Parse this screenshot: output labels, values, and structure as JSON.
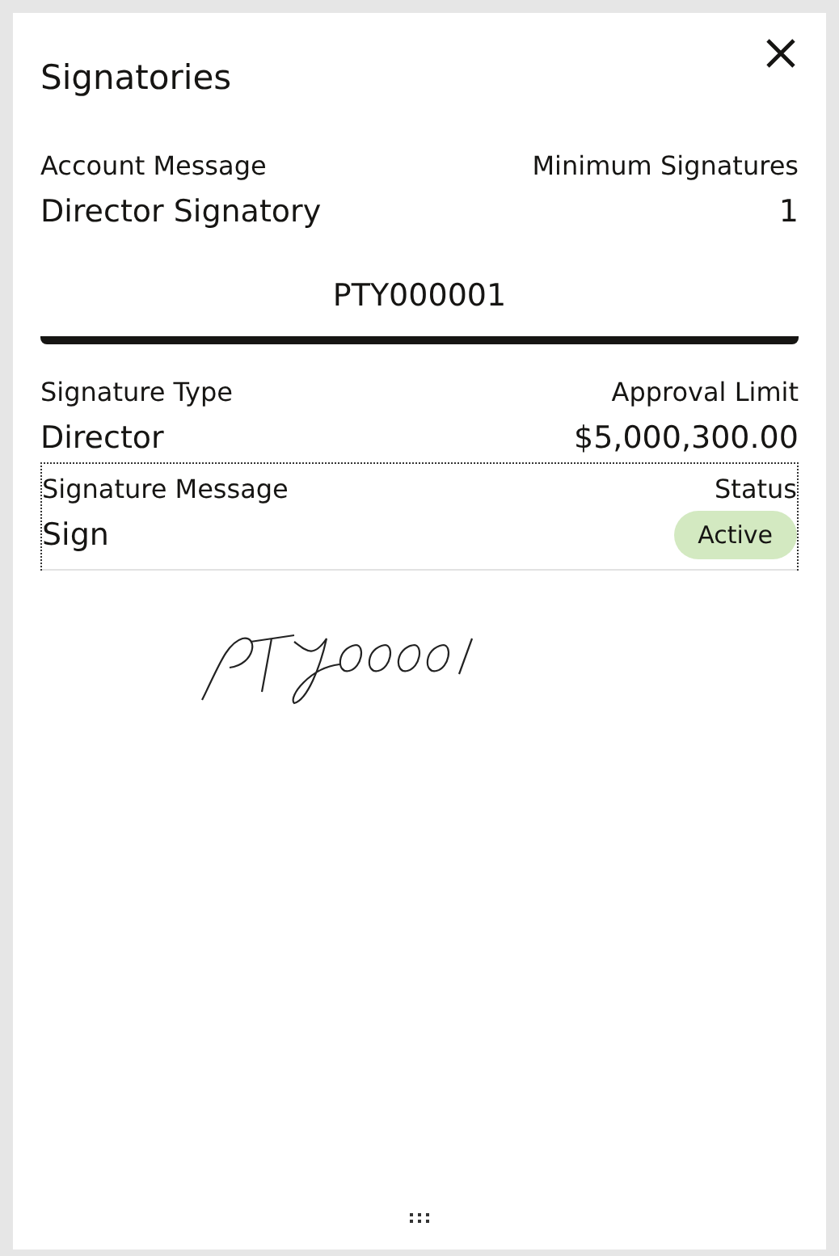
{
  "dialog": {
    "title": "Signatories"
  },
  "account": {
    "fields": [
      {
        "label": "Account Message",
        "value": "Director Signatory"
      },
      {
        "label": "Minimum Signatures",
        "value": "1"
      }
    ]
  },
  "tabs": [
    {
      "label": "PTY000001",
      "selected": true
    }
  ],
  "signatory": {
    "fields": [
      {
        "label": "Signature Type",
        "value": "Director"
      },
      {
        "label": "Approval Limit",
        "value": "$5,000,300.00"
      }
    ],
    "message_label": "Signature Message",
    "message": "Sign",
    "status_label": "Status",
    "status": {
      "label": "Active",
      "color": "#d3e9c1"
    }
  }
}
